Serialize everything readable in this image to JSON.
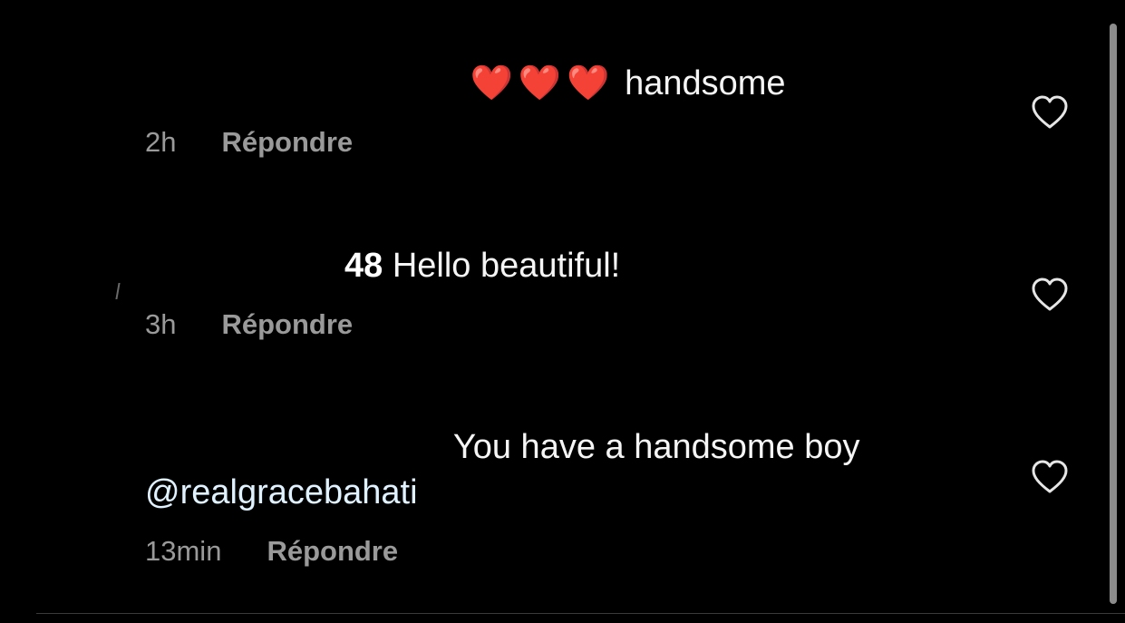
{
  "comments": [
    {
      "username": "",
      "visible_username_fragment": "",
      "hearts": "❤️❤️❤️",
      "text": "handsome",
      "mention": "",
      "time": "2h",
      "reply_label": "Répondre"
    },
    {
      "username": "",
      "visible_username_fragment": "48",
      "hearts": "",
      "text": "Hello beautiful!",
      "mention": "",
      "time": "3h",
      "reply_label": "Répondre"
    },
    {
      "username": "",
      "visible_username_fragment": "",
      "hearts": "",
      "text": "You have a handsome boy",
      "mention": "@realgracebahati",
      "time": "13min",
      "reply_label": "Répondre"
    }
  ],
  "icons": {
    "like": "heart-outline-icon"
  },
  "colors": {
    "background": "#000000",
    "text": "#f5f5f5",
    "meta": "#9a9a9a",
    "mention": "#e0f1ff",
    "heart": "#ff2d2d"
  }
}
